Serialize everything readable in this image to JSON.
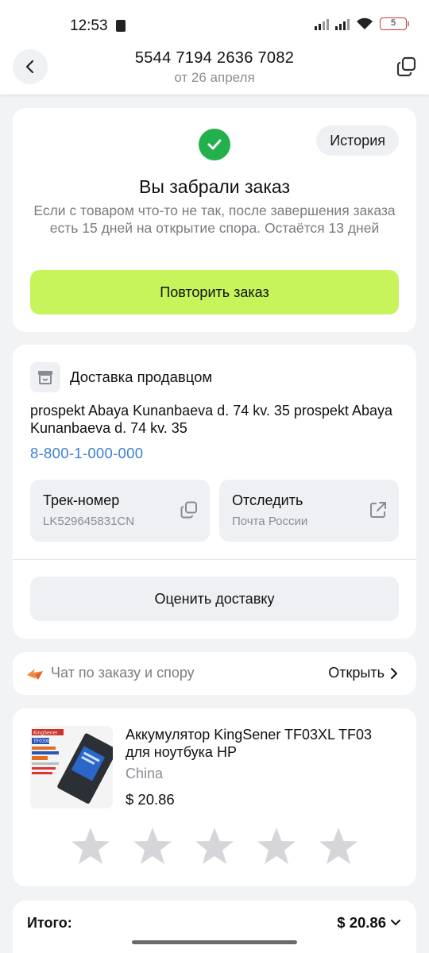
{
  "status_bar": {
    "time": "12:53",
    "battery": "5"
  },
  "header": {
    "order_number": "5544 7194 2636 7082",
    "date": "от 26 апреля",
    "back_icon": "chevron-left-icon",
    "copy_icon": "copy-icon"
  },
  "order_status": {
    "history_label": "История",
    "title": "Вы забрали заказ",
    "description": "Если с товаром что-то не так, после завершения заказа есть 15 дней на открытие спора. Остаётся 13 дней",
    "repeat_button": "Повторить заказ",
    "accent_color": "#c6f45a",
    "check_color": "#22b14c"
  },
  "delivery": {
    "title": "Доставка продавцом",
    "address": "prospekt Abaya Kunanbaeva d. 74 kv. 35 prospekt Abaya Kunanbaeva d. 74 kv. 35",
    "phone": "8-800-1-000-000",
    "track": {
      "title": "Трек-номер",
      "value": "LK529645831CN"
    },
    "follow": {
      "title": "Отследить",
      "carrier": "Почта России"
    },
    "rate_button": "Оценить доставку"
  },
  "chat": {
    "label": "Чат по заказу и спору",
    "action": "Открыть"
  },
  "product": {
    "name": "Аккумулятор KingSener TF03XL TF03 для ноутбука HP",
    "origin": "China",
    "price": "$ 20.86",
    "image_brand": "KingSener",
    "image_model": "TF03XL",
    "rating_stars": 5,
    "rating_value": 0
  },
  "total": {
    "label": "Итого:",
    "value": "$ 20.86"
  }
}
